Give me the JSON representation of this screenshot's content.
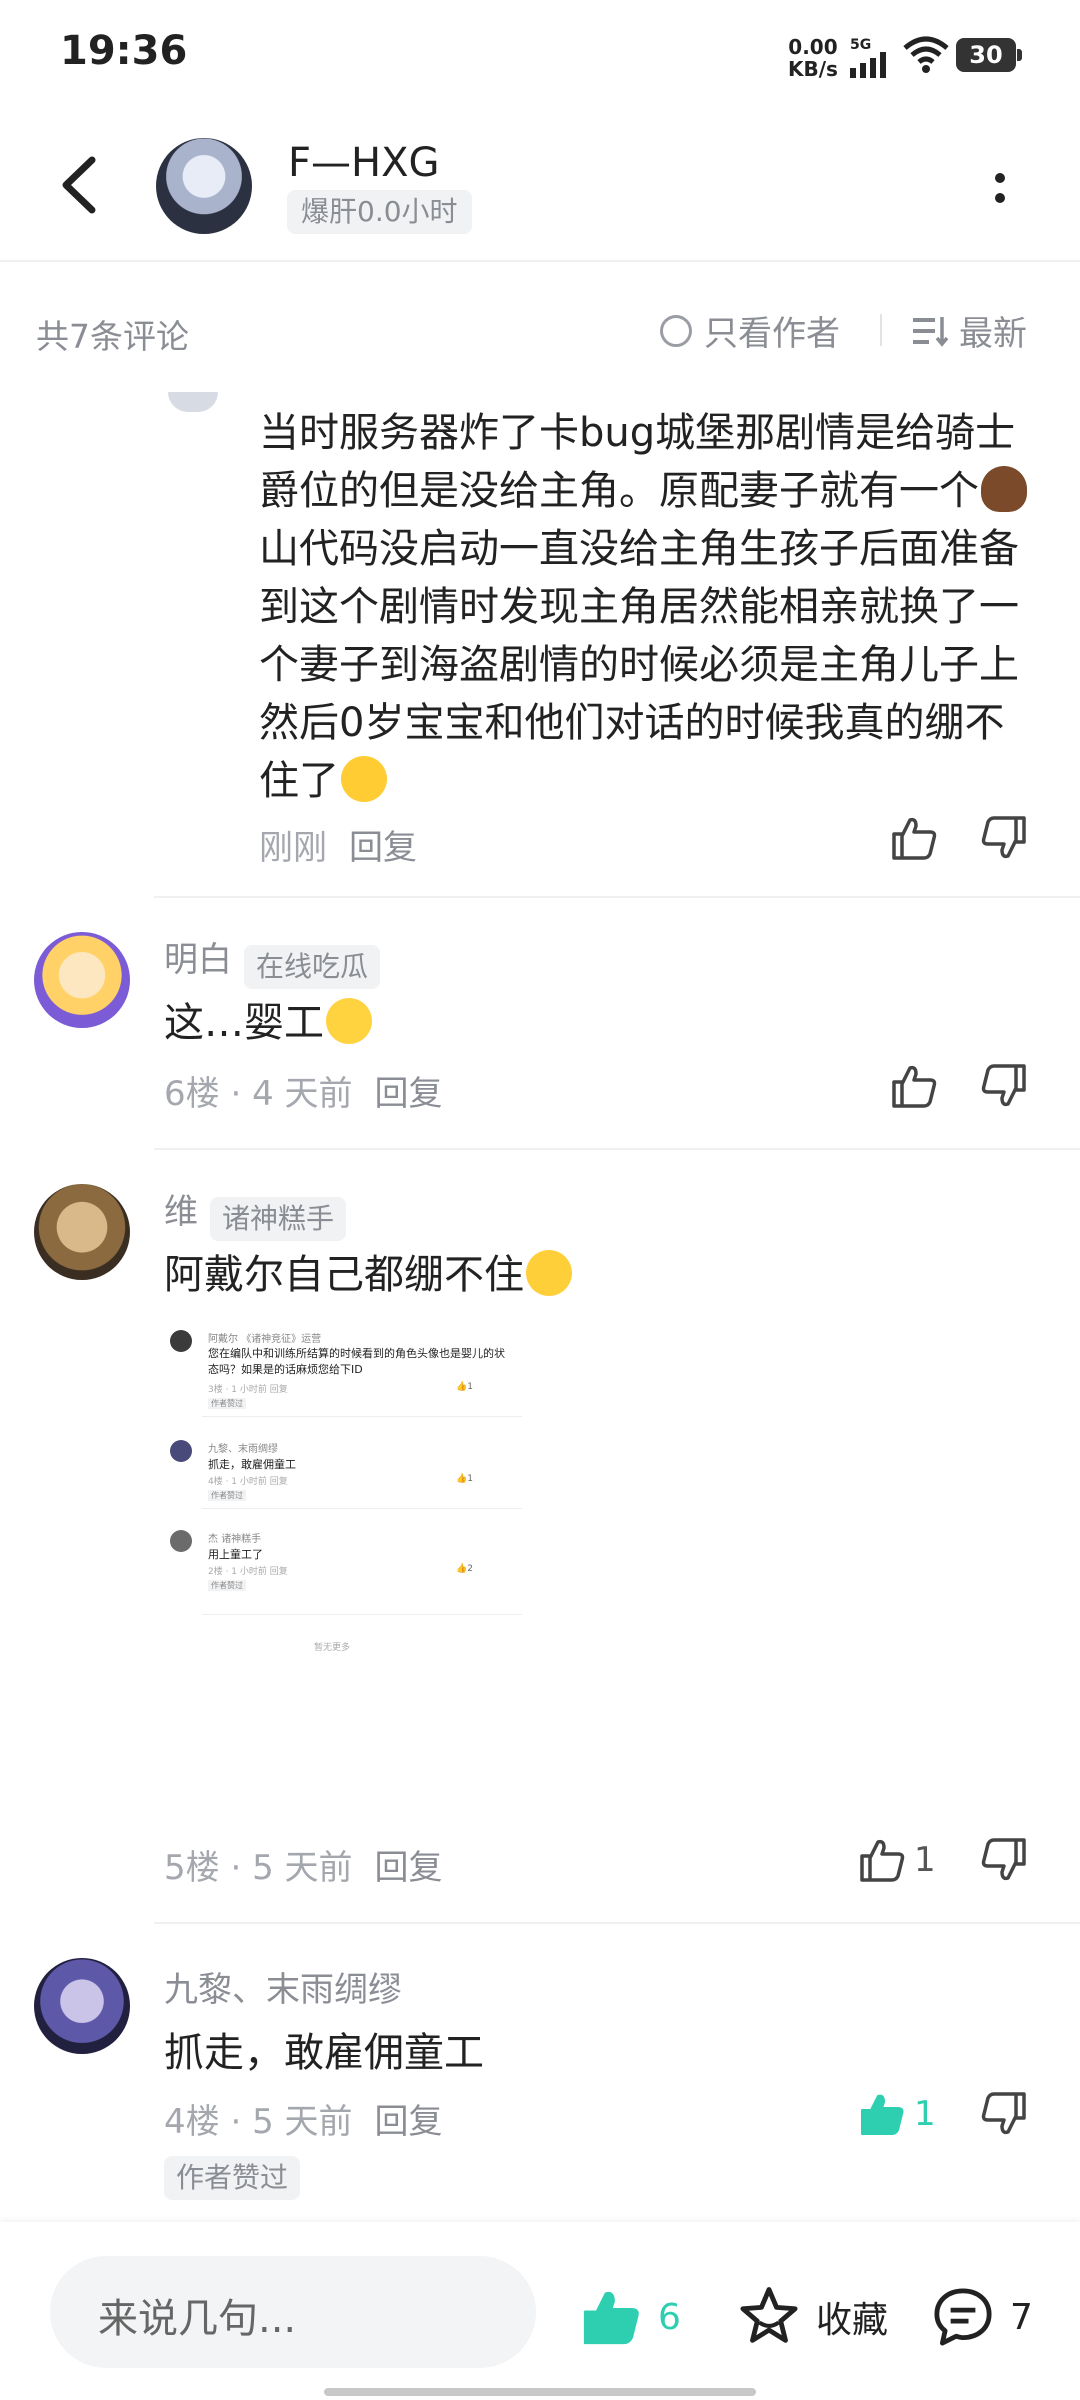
{
  "status_bar": {
    "time": "19:36",
    "net_speed_value": "0.00",
    "net_speed_unit": "KB/s",
    "network": "5G",
    "battery": "30"
  },
  "header": {
    "author_name": "F—HXG",
    "author_badge": "爆肝0.0小时"
  },
  "filter_bar": {
    "count": "共7条评论",
    "only_author": "只看作者",
    "sort": "最新"
  },
  "comments": [
    {
      "text_1": "当时服务器炸了卡bug城堡那剧情是给骑士爵位的但是没给主角。原配妻子就有一个",
      "text_2": "山代码没启动一直没给主角生孩子后面准备到这个剧情时发现主角居然能相亲就换了一个妻子到海盗剧情的时候必须是主角儿子上然后0岁宝宝和他们对话的时候我真的绷不住了",
      "time": "刚刚",
      "reply": "回复"
    },
    {
      "user": "明白",
      "tag": "在线吃瓜",
      "text": "这…婴工",
      "floor": "6楼",
      "time": "4 天前",
      "reply": "回复"
    },
    {
      "user": "维",
      "tag": "诸神糕手",
      "text": "阿戴尔自己都绷不住",
      "floor": "5楼",
      "time": "5 天前",
      "reply": "回复",
      "likes": "1",
      "screenshot": {
        "c1_user": "阿戴尔",
        "c1_tag": "《诸神竞征》运营",
        "c1_text": "您在编队中和训练所结算的时候看到的角色头像也是婴儿的状态吗？如果是的话麻烦您给下ID",
        "c1_meta": "3楼 · 1 小时前  回复",
        "c1_likes": "1",
        "c1_badge": "作者赞过",
        "c2_user": "九黎、末雨绸缪",
        "c2_text": "抓走，敢雇佣童工",
        "c2_meta": "4楼 · 1 小时前  回复",
        "c2_likes": "1",
        "c2_badge": "作者赞过",
        "c3_user": "杰",
        "c3_tag": "诸神糕手",
        "c3_text": "用上童工了",
        "c3_meta": "2楼 · 1 小时前  回复",
        "c3_likes": "2",
        "c3_badge": "作者赞过",
        "end": "暂无更多"
      }
    },
    {
      "user": "九黎、末雨绸缪",
      "text": "抓走，敢雇佣童工",
      "floor": "4楼",
      "time": "5 天前",
      "reply": "回复",
      "likes": "1",
      "badge": "作者赞过"
    }
  ],
  "bottom_bar": {
    "placeholder": "来说几句...",
    "likes": "6",
    "favorite": "收藏",
    "comments": "7"
  },
  "colors": {
    "accent": "#2ecfb1",
    "muted": "#8a8d94",
    "text": "#222222"
  }
}
